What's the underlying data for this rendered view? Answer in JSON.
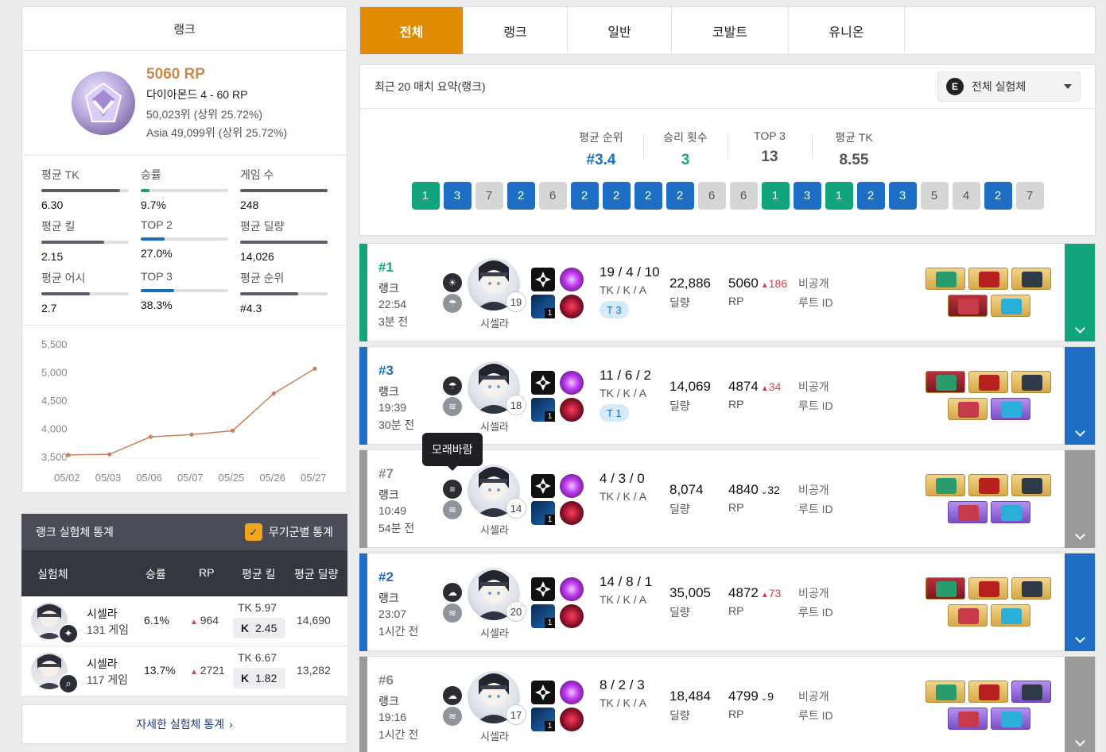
{
  "rank_card": {
    "title": "랭크",
    "rp": "5060 RP",
    "tier": "다이아몬드 4 - 60 RP",
    "global_rank": "50,023위 (상위 25.72%)",
    "region_rank": "Asia 49,099위 (상위 25.72%)",
    "stats": [
      {
        "label": "평균 TK",
        "value": "6.30",
        "level": 0.9,
        "color": "#5a5f69"
      },
      {
        "label": "승률",
        "value": "9.7%",
        "level": 0.1,
        "color": "#12a57d"
      },
      {
        "label": "게임 수",
        "value": "248",
        "level": 1.0,
        "color": "#5a5f69"
      },
      {
        "label": "평균 킬",
        "value": "2.15",
        "level": 0.72,
        "color": "#5a5f69"
      },
      {
        "label": "TOP 2",
        "value": "27.0%",
        "level": 0.27,
        "color": "#1a6fc0"
      },
      {
        "label": "평균 딜량",
        "value": "14,026",
        "level": 1.0,
        "color": "#5a5f69"
      },
      {
        "label": "평균 어시",
        "value": "2.7",
        "level": 0.55,
        "color": "#5a5f69"
      },
      {
        "label": "TOP 3",
        "value": "38.3%",
        "level": 0.38,
        "color": "#1a6fc0"
      },
      {
        "label": "평균 순위",
        "value": "#4.3",
        "level": 0.66,
        "color": "#5a5f69"
      }
    ]
  },
  "chart_data": {
    "type": "line",
    "categories": [
      "05/02",
      "05/03",
      "05/06",
      "05/07",
      "05/25",
      "05/26",
      "05/27"
    ],
    "values": [
      3530,
      3540,
      3850,
      3890,
      3960,
      4620,
      5060
    ],
    "y_ticks": [
      "5,500",
      "5,000",
      "4,500",
      "4,000",
      "3,500"
    ],
    "ylim": [
      3500,
      5500
    ],
    "color": "#c9835a"
  },
  "exp_stats": {
    "title": "랭크 실험체 통계",
    "toggle_label": "무기군별 통계",
    "headers": {
      "char": "실험체",
      "winrate": "승률",
      "rp": "RP",
      "avg_kill": "평균 킬",
      "avg_dmg": "평균 딜량"
    },
    "rows": [
      {
        "name": "시셀라",
        "games": "131 게임",
        "winrate": "6.1%",
        "rp": "964",
        "tk": "TK 5.97",
        "k_label": "K",
        "k": "2.45",
        "dmg": "14,690",
        "weapon_icon": "shuriken-icon"
      },
      {
        "name": "시셀라",
        "games": "117 게임",
        "winrate": "13.7%",
        "rp": "2721",
        "tk": "TK 6.67",
        "k_label": "K",
        "k": "1.82",
        "dmg": "13,282",
        "weapon_icon": "search-icon"
      }
    ],
    "detail_link": "자세한 실험체 통계"
  },
  "tabs": [
    "전체",
    "랭크",
    "일반",
    "코발트",
    "유니온"
  ],
  "summary": {
    "title": "최근 20 매치 요약",
    "title_suffix": "(랭크)",
    "filter": "전체 실험체",
    "kpis": [
      {
        "label": "평균 순위",
        "value": "#3.4",
        "style": "blue"
      },
      {
        "label": "승리 횟수",
        "value": "3",
        "style": "green"
      },
      {
        "label": "TOP 3",
        "value": "13",
        "style": ""
      },
      {
        "label": "평균 TK",
        "value": "8.55",
        "style": ""
      }
    ],
    "placements": [
      "1",
      "3",
      "7",
      "2",
      "6",
      "2",
      "2",
      "2",
      "2",
      "6",
      "6",
      "1",
      "3",
      "1",
      "2",
      "3",
      "5",
      "4",
      "2",
      "7"
    ]
  },
  "tooltip": "모래바람",
  "matches": [
    {
      "placement": "#1",
      "type": "랭크",
      "time": "22:54",
      "ago": "3분 전",
      "level": "19",
      "char": "시셀라",
      "kda": "19 / 4 / 10",
      "kda_label": "TK / K / A",
      "badge": "T 3",
      "damage": "22,886",
      "damage_label": "딜량",
      "rp": "5060",
      "rp_change": "186",
      "rp_dir": "up",
      "rp_label": "RP",
      "privacy": "비공개",
      "route": "루트 ID",
      "color": "#12a57d",
      "weather": [
        "sun-icon",
        "rain-cloud-icon"
      ]
    },
    {
      "placement": "#3",
      "type": "랭크",
      "time": "19:39",
      "ago": "30분 전",
      "level": "18",
      "char": "시셀라",
      "kda": "11 / 6 / 2",
      "kda_label": "TK / K / A",
      "badge": "T 1",
      "damage": "14,069",
      "damage_label": "딜량",
      "rp": "4874",
      "rp_change": "34",
      "rp_dir": "up",
      "rp_label": "RP",
      "privacy": "비공개",
      "route": "루트 ID",
      "color": "#1e6fc4",
      "weather": [
        "rain-cloud-icon",
        "wind-icon"
      ]
    },
    {
      "placement": "#7",
      "type": "랭크",
      "time": "10:49",
      "ago": "54분 전",
      "level": "14",
      "char": "시셀라",
      "kda": "4 / 3 / 0",
      "kda_label": "TK / K / A",
      "badge": "",
      "damage": "8,074",
      "damage_label": "딜량",
      "rp": "4840",
      "rp_change": "32",
      "rp_dir": "down",
      "rp_label": "RP",
      "privacy": "비공개",
      "route": "루트 ID",
      "color": "#9a9a9a",
      "weather": [
        "sandstorm-icon",
        "wind-icon"
      ]
    },
    {
      "placement": "#2",
      "type": "랭크",
      "time": "23:07",
      "ago": "1시간 전",
      "level": "20",
      "char": "시셀라",
      "kda": "14 / 8 / 1",
      "kda_label": "TK / K / A",
      "badge": "",
      "damage": "35,005",
      "damage_label": "딜량",
      "rp": "4872",
      "rp_change": "73",
      "rp_dir": "up",
      "rp_label": "RP",
      "privacy": "비공개",
      "route": "루트 ID",
      "color": "#1e6fc4",
      "weather": [
        "cloud-icon",
        "wind-icon"
      ]
    },
    {
      "placement": "#6",
      "type": "랭크",
      "time": "19:16",
      "ago": "1시간 전",
      "level": "17",
      "char": "시셀라",
      "kda": "8 / 2 / 3",
      "kda_label": "TK / K / A",
      "badge": "",
      "damage": "18,484",
      "damage_label": "딜량",
      "rp": "4799",
      "rp_change": "9",
      "rp_dir": "down",
      "rp_label": "RP",
      "privacy": "비공개",
      "route": "루트 ID",
      "color": "#9a9a9a",
      "weather": [
        "cloud-icon",
        "wind-icon"
      ]
    }
  ],
  "items": [
    [
      "gold",
      "gold",
      "gold",
      "red",
      "gold"
    ],
    [
      "red",
      "gold",
      "gold",
      "gold",
      "purp"
    ],
    [
      "gold",
      "gold",
      "gold",
      "purp",
      "purp"
    ],
    [
      "red",
      "gold",
      "gold",
      "gold",
      "gold"
    ],
    [
      "gold",
      "gold",
      "purp",
      "purp",
      "purp"
    ]
  ]
}
